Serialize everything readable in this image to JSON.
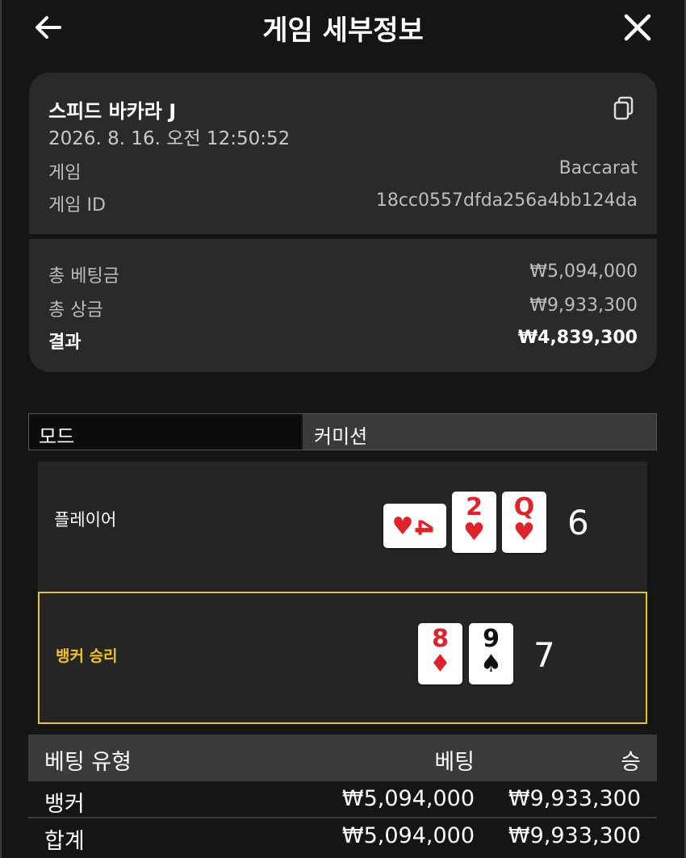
{
  "header": {
    "title": "게임 세부정보",
    "back_icon": "arrow-left-icon",
    "close_icon": "close-icon"
  },
  "info": {
    "game_name": "스피드 바카라 J",
    "datetime": "2026. 8. 16. 오전 12:50:52",
    "copy_icon": "copy-icon",
    "game_label": "게임",
    "game_value": "Baccarat",
    "game_id_label": "게임 ID",
    "game_id_value": "18cc0557dfda256a4bb124da",
    "total_bet_label": "총 베팅금",
    "total_bet_value": "₩5,094,000",
    "total_win_label": "총 상금",
    "total_win_value": "₩9,933,300",
    "result_label": "결과",
    "result_value": "₩4,839,300"
  },
  "mode": {
    "mode_label": "모드",
    "mode_value": "커미션"
  },
  "player": {
    "label": "플레이어",
    "score": "6",
    "cards": [
      {
        "rank": "4",
        "suit": "♥",
        "color": "#e0232a",
        "orientation": "sideways"
      },
      {
        "rank": "2",
        "suit": "♥",
        "color": "#e0232a"
      },
      {
        "rank": "Q",
        "suit": "♥",
        "color": "#e0232a"
      }
    ]
  },
  "banker": {
    "label": "뱅커 승리",
    "score": "7",
    "highlight_color": "#e6c42e",
    "cards": [
      {
        "rank": "8",
        "suit": "♦",
        "color": "#e0232a"
      },
      {
        "rank": "9",
        "suit": "♠",
        "color": "#111111"
      }
    ]
  },
  "bets": {
    "headers": [
      "베팅 유형",
      "베팅",
      "승"
    ],
    "rows": [
      {
        "type": "뱅커",
        "bet": "₩5,094,000",
        "win": "₩9,933,300"
      },
      {
        "type": "합계",
        "bet": "₩5,094,000",
        "win": "₩9,933,300"
      }
    ]
  }
}
